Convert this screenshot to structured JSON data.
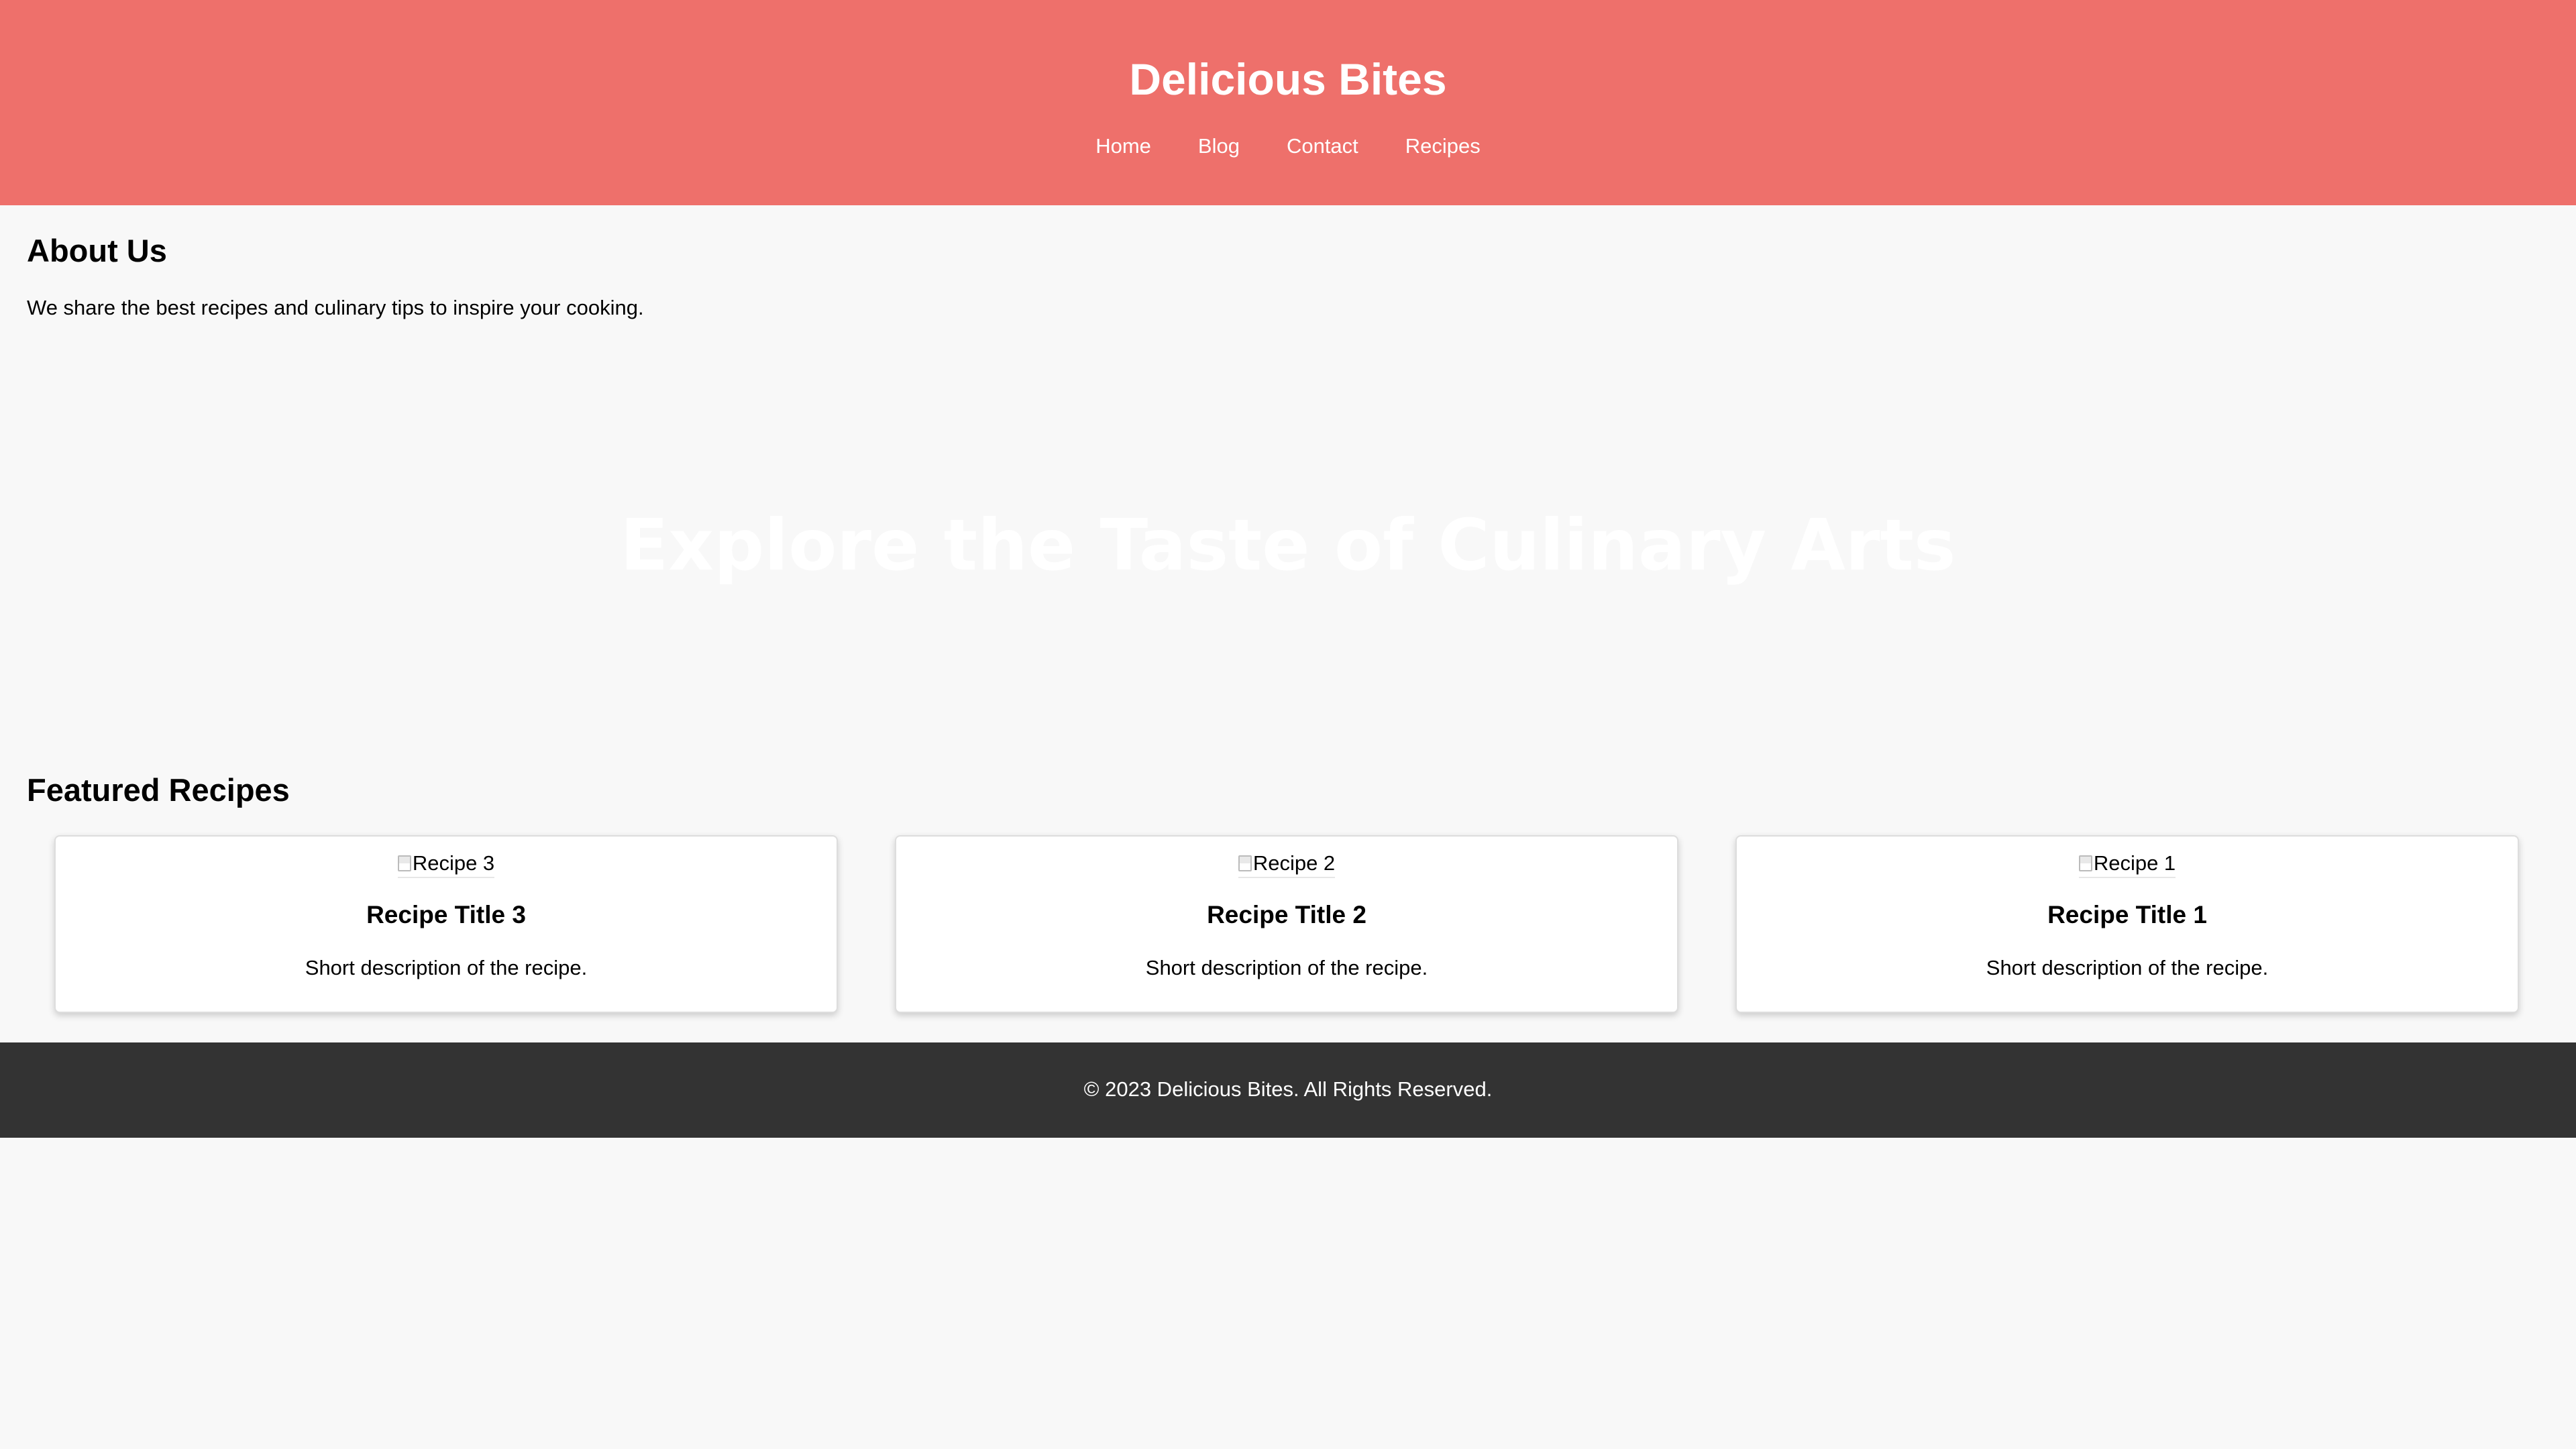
{
  "header": {
    "title": "Delicious Bites",
    "nav": [
      {
        "label": "Home"
      },
      {
        "label": "Blog"
      },
      {
        "label": "Contact"
      },
      {
        "label": "Recipes"
      }
    ]
  },
  "about": {
    "title": "About Us",
    "text": "We share the best recipes and culinary tips to inspire your cooking."
  },
  "hero": {
    "title": "Explore the Taste of Culinary Arts"
  },
  "featured": {
    "title": "Featured Recipes",
    "cards": [
      {
        "image_alt": "Recipe 3",
        "title": "Recipe Title 3",
        "description": "Short description of the recipe."
      },
      {
        "image_alt": "Recipe 2",
        "title": "Recipe Title 2",
        "description": "Short description of the recipe."
      },
      {
        "image_alt": "Recipe 1",
        "title": "Recipe Title 1",
        "description": "Short description of the recipe."
      }
    ]
  },
  "footer": {
    "text": "© 2023 Delicious Bites. All Rights Reserved."
  },
  "colors": {
    "header_bg": "#ee706b",
    "page_bg": "#f8f8f8",
    "footer_bg": "#333333",
    "card_bg": "#ffffff"
  },
  "icons": {
    "broken_image": "broken-image-icon"
  }
}
